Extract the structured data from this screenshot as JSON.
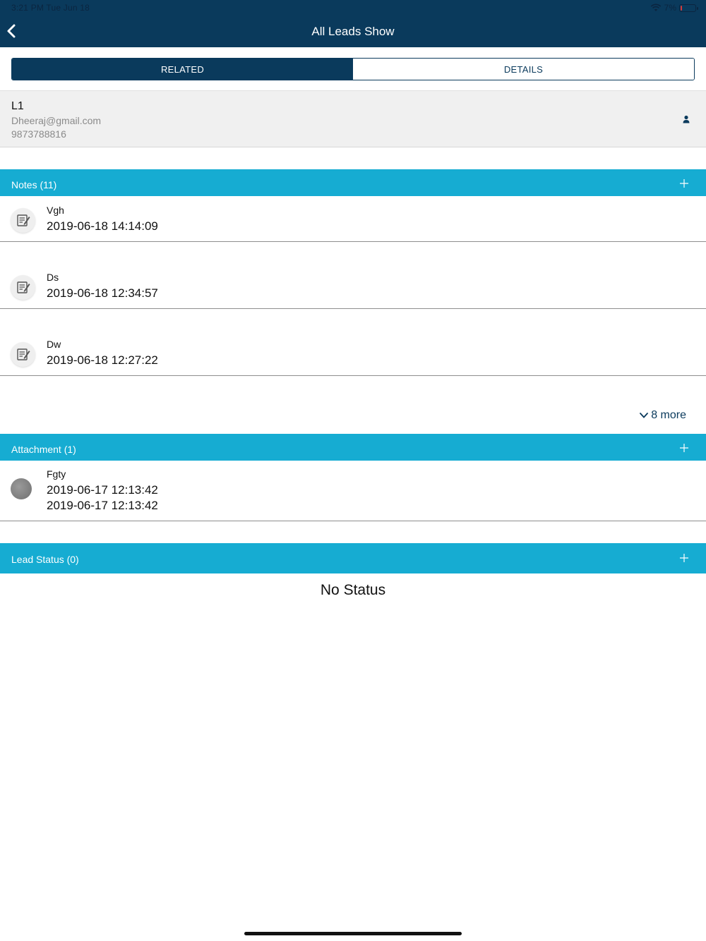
{
  "status_bar": {
    "time": "3:21 PM   Tue Jun 18",
    "battery": "7%"
  },
  "nav": {
    "title": "All Leads Show"
  },
  "tabs": [
    {
      "label": "RELATED",
      "active": true
    },
    {
      "label": "DETAILS",
      "active": false
    }
  ],
  "lead": {
    "name": "L1",
    "email": "Dheeraj@gmail.com",
    "phone": "9873788816"
  },
  "notes": {
    "header": "Notes (11)",
    "items": [
      {
        "title": "Vgh",
        "date": "2019-06-18 14:14:09"
      },
      {
        "title": "Ds",
        "date": "2019-06-18 12:34:57"
      },
      {
        "title": "Dw",
        "date": "2019-06-18 12:27:22"
      }
    ],
    "more_label": "8 more"
  },
  "attachments": {
    "header": "Attachment (1)",
    "items": [
      {
        "title": "Fgty",
        "created": "2019-06-17 12:13:42",
        "modified": "2019-06-17 12:13:42"
      }
    ]
  },
  "lead_status": {
    "header": "Lead Status (0)",
    "empty_text": "No Status"
  },
  "colors": {
    "nav_bg": "#0a3a5c",
    "section_bg": "#16acd2",
    "card_bg": "#f0f0f0"
  }
}
